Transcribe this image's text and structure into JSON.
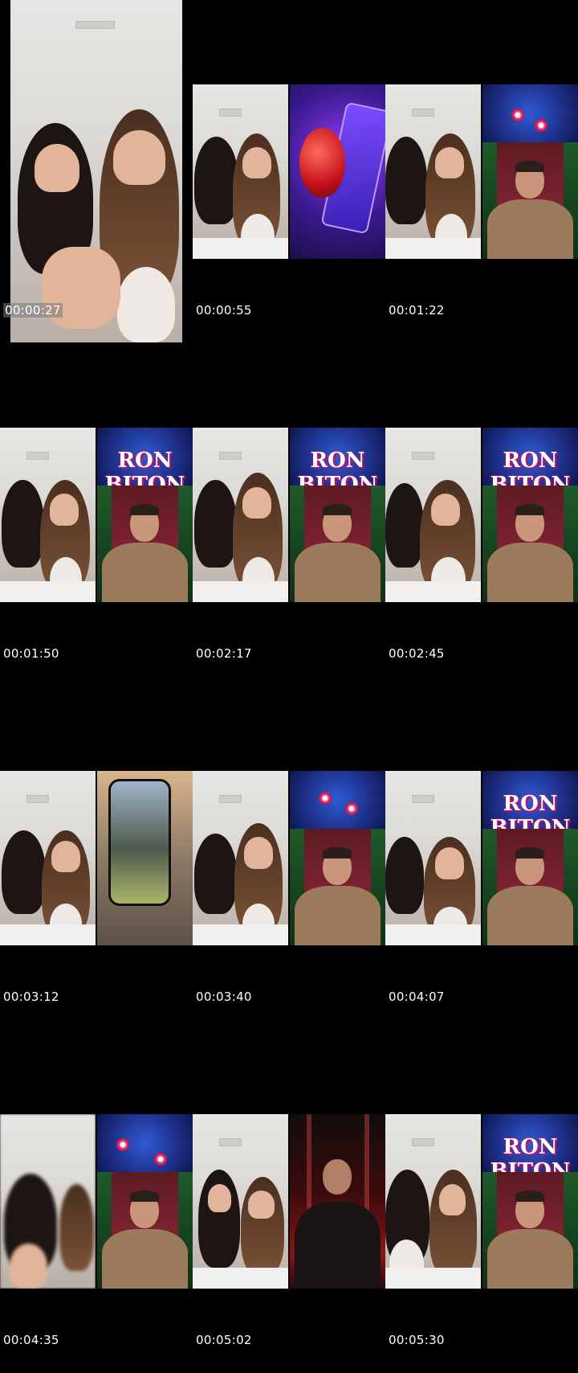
{
  "timestamps": [
    "00:00:27",
    "00:00:55",
    "00:01:22",
    "00:01:50",
    "00:02:17",
    "00:02:45",
    "00:03:12",
    "00:03:40",
    "00:04:07",
    "00:04:35",
    "00:05:02",
    "00:05:30"
  ],
  "banner": {
    "text": "RON BITON"
  },
  "colors": {
    "background": "#000000",
    "timestamp_text": "#ffffff",
    "banner_blue": "#1d2f88",
    "studio_red": "#7b2230"
  }
}
